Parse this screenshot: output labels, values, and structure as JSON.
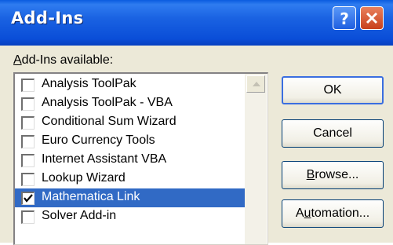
{
  "window": {
    "title": "Add-Ins",
    "help_icon": "question-mark-icon",
    "close_icon": "close-x-icon"
  },
  "list": {
    "label_prefix": "A",
    "label_rest": "dd-Ins available:",
    "items": [
      {
        "label": "Analysis ToolPak",
        "checked": false,
        "selected": false
      },
      {
        "label": "Analysis ToolPak - VBA",
        "checked": false,
        "selected": false
      },
      {
        "label": "Conditional Sum Wizard",
        "checked": false,
        "selected": false
      },
      {
        "label": "Euro Currency Tools",
        "checked": false,
        "selected": false
      },
      {
        "label": "Internet Assistant VBA",
        "checked": false,
        "selected": false
      },
      {
        "label": "Lookup Wizard",
        "checked": false,
        "selected": false
      },
      {
        "label": "Mathematica Link",
        "checked": true,
        "selected": true
      },
      {
        "label": "Solver Add-in",
        "checked": false,
        "selected": false
      }
    ]
  },
  "buttons": {
    "ok": "OK",
    "cancel": "Cancel",
    "browse_prefix": "B",
    "browse_rest": "rowse...",
    "automation_prefix": "A",
    "automation_mid": "u",
    "automation_rest": "tomation..."
  },
  "colors": {
    "selection": "#316ac5",
    "titlebar": "#0a4ed8",
    "dialog_bg": "#ece9d8"
  }
}
